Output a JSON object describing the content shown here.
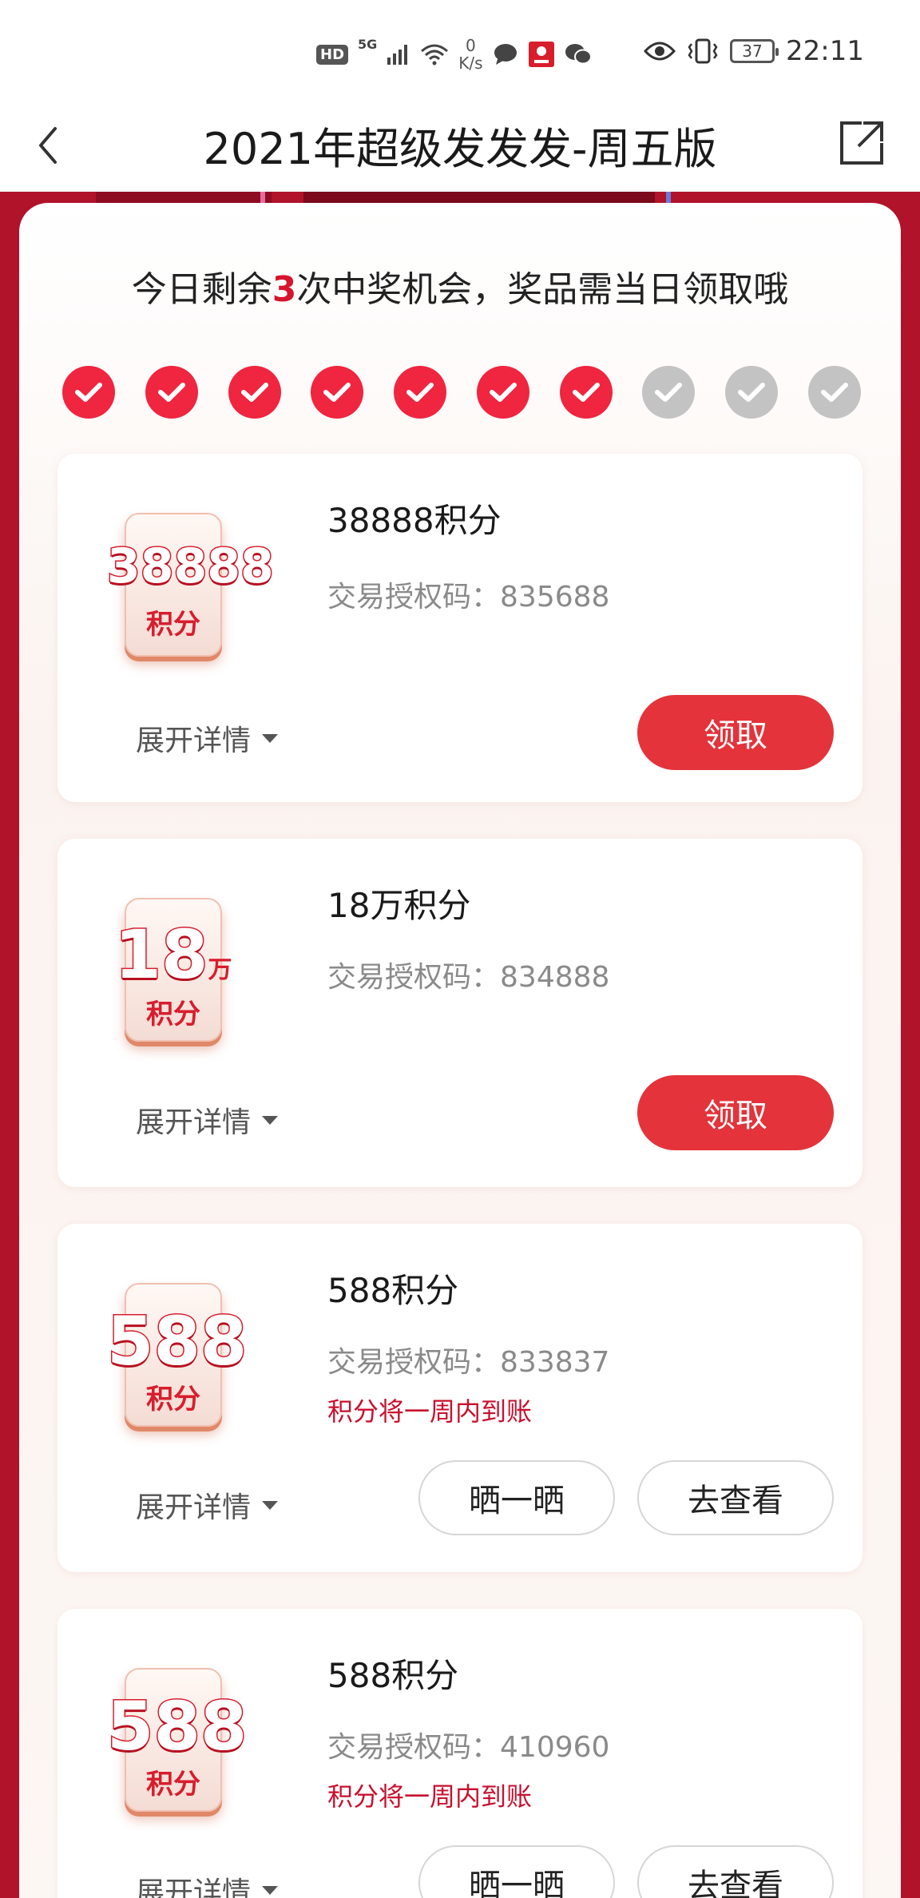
{
  "status_bar": {
    "network_badge": "HD",
    "network_type": "5G",
    "speed_value": "0",
    "speed_unit": "K/s",
    "battery": "37",
    "time": "22:11"
  },
  "nav": {
    "title": "2021年超级发发发-周五版"
  },
  "header": {
    "prefix": "今日剩余",
    "count": "3",
    "suffix": "次中奖机会，奖品需当日领取哦"
  },
  "progress": {
    "completed": 7,
    "total": 10
  },
  "prizes": [
    {
      "tile_number": "38888",
      "tile_unit": "积分",
      "name": "38888积分",
      "auth_label": "交易授权码：",
      "auth_code": "835688",
      "note": "",
      "expand_label": "展开详情",
      "claim_label": "领取"
    },
    {
      "tile_number": "18",
      "tile_wan": "万",
      "tile_unit": "积分",
      "name": "18万积分",
      "auth_label": "交易授权码：",
      "auth_code": "834888",
      "note": "",
      "expand_label": "展开详情",
      "claim_label": "领取"
    },
    {
      "tile_number": "588",
      "tile_unit": "积分",
      "name": "588积分",
      "auth_label": "交易授权码：",
      "auth_code": "833837",
      "note": "积分将一周内到账",
      "expand_label": "展开详情",
      "share_label": "晒一晒",
      "view_label": "去查看"
    },
    {
      "tile_number": "588",
      "tile_unit": "积分",
      "name": "588积分",
      "auth_label": "交易授权码：",
      "auth_code": "410960",
      "note": "积分将一周内到账",
      "expand_label": "展开详情",
      "share_label": "晒一晒",
      "view_label": "去查看"
    }
  ]
}
